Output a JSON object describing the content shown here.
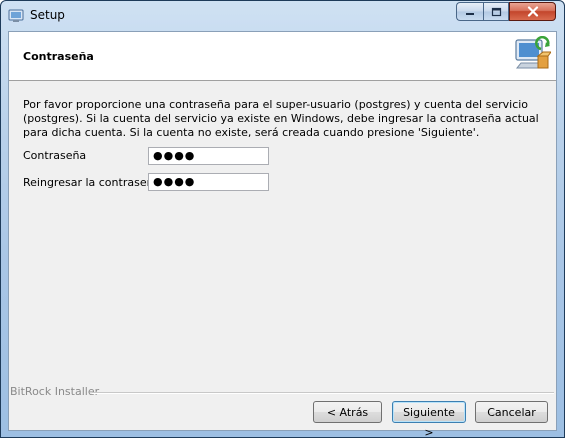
{
  "window": {
    "title": "Setup",
    "minimize_icon": "minimize-icon",
    "maximize_icon": "maximize-icon",
    "close_icon": "close-icon"
  },
  "header": {
    "title": "Contraseña",
    "icon": "installer-computer-icon"
  },
  "body": {
    "description": "Por favor proporcione una contraseña para el super-usuario (postgres) y cuenta del servicio (postgres). Si la cuenta del servicio ya existe en Windows, debe ingresar la contraseña actual para dicha cuenta. Si la cuenta no existe, será creada cuando presione 'Siguiente'.",
    "fields": [
      {
        "label": "Contraseña",
        "value": "●●●●"
      },
      {
        "label": "Reingresar la contraseña",
        "value": "●●●●"
      }
    ]
  },
  "footer": {
    "brand": "BitRock Installer",
    "back_label": "< Atrás",
    "next_label": "Siguiente >",
    "cancel_label": "Cancelar"
  },
  "colors": {
    "titlebar": "#b9d1ea",
    "close_button": "#c3452b",
    "dialog_bg": "#f0f0f0"
  }
}
